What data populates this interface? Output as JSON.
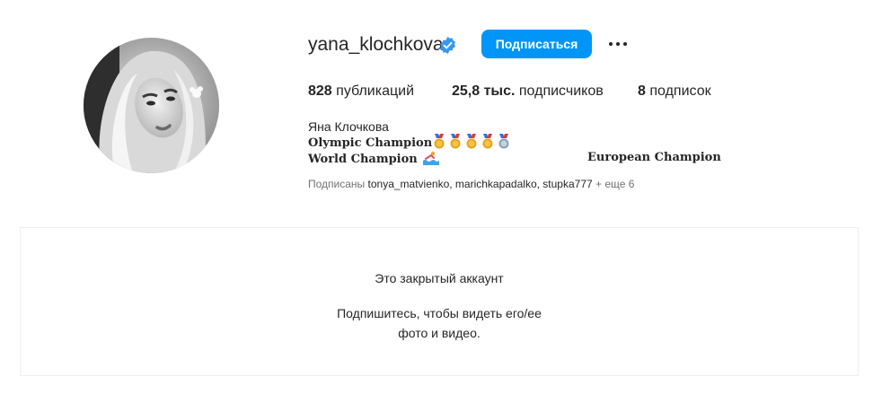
{
  "profile": {
    "username": "yana_klochkova",
    "verified_icon": "verified-badge-icon",
    "follow_label": "Подписаться",
    "more_icon": "more-options-icon",
    "avatar_icon": "profile-avatar"
  },
  "stats": {
    "posts_count": "828",
    "posts_label": "публикаций",
    "followers_count": "25,8 тыс.",
    "followers_label": "подписчиков",
    "following_count": "8",
    "following_label": "подписок"
  },
  "bio": {
    "full_name": "Яна Клочкова",
    "line1": "Olympic Champion",
    "line1_medals": [
      "gold-medal",
      "gold-medal",
      "gold-medal",
      "gold-medal",
      "silver-medal"
    ],
    "line2": "World Champion",
    "line2_icon": "swimmer-icon",
    "line2_extra": "European Champion"
  },
  "followed_by": {
    "prefix": "Подписаны",
    "accounts": "tonya_matvienko, marichkapadalko, stupka777",
    "suffix": "+ еще 6"
  },
  "private": {
    "title": "Это закрытый аккаунт",
    "line1": "Подпишитесь, чтобы видеть его/ее",
    "line2": "фото и видео."
  },
  "colors": {
    "accent": "#0095f6",
    "text": "#262626",
    "secondary": "#737373",
    "border": "#efefef"
  }
}
